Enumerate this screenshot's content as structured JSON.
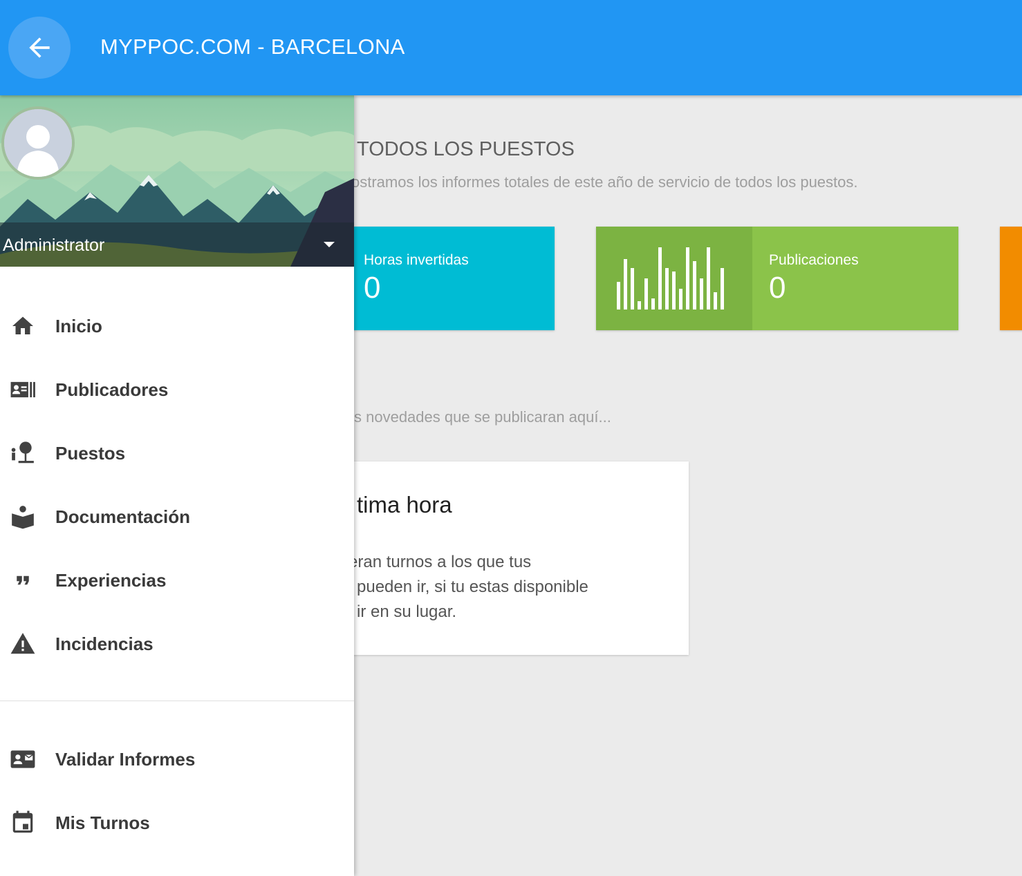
{
  "appbar": {
    "title": "MYPPOC.COM - BARCELONA",
    "back_icon": "arrow-back-icon"
  },
  "dashboard": {
    "title": "TODOS LOS PUESTOS",
    "subtitle": "ostramos los informes totales de este año de servicio de todos los puestos.",
    "stats": [
      {
        "label": "Horas invertidas",
        "value": "0",
        "color": "#00bcd4"
      },
      {
        "label": "Publicaciones",
        "value": "0",
        "color": "#8bc34a",
        "accent": "#7cb342",
        "icon": "bar-chart-icon"
      }
    ],
    "news_subtitle": "s novedades que se publicaran aquí...",
    "news_card": {
      "title": "tima hora",
      "body_lines": [
        "eran turnos a los que tus",
        "pueden ir, si tu estas disponible",
        "ir en su lugar."
      ]
    }
  },
  "drawer": {
    "user": {
      "name": "Administrator",
      "avatar_icon": "person-avatar-icon",
      "caret_icon": "caret-down-icon"
    },
    "items": [
      {
        "label": "Inicio",
        "icon": "home-icon"
      },
      {
        "label": "Publicadores",
        "icon": "contacts-icon"
      },
      {
        "label": "Puestos",
        "icon": "stand-icon"
      },
      {
        "label": "Documentación",
        "icon": "book-icon"
      },
      {
        "label": "Experiencias",
        "icon": "quote-icon"
      },
      {
        "label": "Incidencias",
        "icon": "warning-icon"
      }
    ],
    "secondary_items": [
      {
        "label": "Validar Informes",
        "icon": "contact-mail-icon"
      },
      {
        "label": "Mis Turnos",
        "icon": "calendar-icon"
      }
    ]
  },
  "colors": {
    "primary": "#2196f3",
    "background": "#ebebeb"
  }
}
